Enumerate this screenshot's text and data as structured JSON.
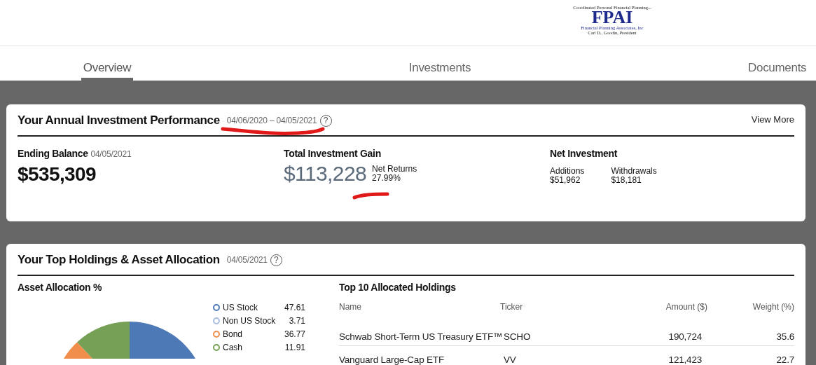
{
  "logo": {
    "tagline": "Coordinated Personal Financial Planning...",
    "name": "FPAI",
    "company": "Financial Planning Associates, Inc",
    "president": "Carl D., Goodin, President"
  },
  "tabs": [
    {
      "label": "Overview",
      "selected": true
    },
    {
      "label": "Investments",
      "selected": false
    },
    {
      "label": "Documents",
      "selected": false
    }
  ],
  "performance": {
    "title": "Your Annual Investment Performance",
    "period": "04/06/2020 – 04/05/2021",
    "help": "?",
    "view_more": "View More",
    "ending_balance": {
      "label": "Ending Balance",
      "date": "04/05/2021",
      "value": "$535,309"
    },
    "gain": {
      "label": "Total Investment Gain",
      "value": "$113,228",
      "returns_label": "Net Returns",
      "returns": "27.99%"
    },
    "net_investment": {
      "label": "Net Investment",
      "items": [
        {
          "label": "Additions",
          "value": "$51,962"
        },
        {
          "label": "Withdrawals",
          "value": "$18,181"
        }
      ]
    }
  },
  "holdings": {
    "title": "Your Top Holdings & Asset Allocation",
    "date": "04/05/2021",
    "help": "?",
    "allocation": {
      "title": "Asset Allocation %",
      "legend": [
        {
          "label": "US Stock",
          "value": "47.61",
          "color": "#4e79b7"
        },
        {
          "label": "Non US Stock",
          "value": "3.71",
          "color": "#a9bde0"
        },
        {
          "label": "Bond",
          "value": "36.77",
          "color": "#f28e4b"
        },
        {
          "label": "Cash",
          "value": "11.91",
          "color": "#76a055"
        }
      ]
    },
    "table": {
      "title": "Top 10 Allocated Holdings",
      "columns": [
        "Name",
        "Ticker",
        "Amount ($)",
        "Weight (%)"
      ],
      "rows": [
        [
          "Schwab Short-Term US Treasury ETF™",
          "SCHO",
          "190,724",
          "35.6"
        ],
        [
          "Vanguard Large-Cap ETF",
          "VV",
          "121,423",
          "22.7"
        ]
      ]
    }
  }
}
